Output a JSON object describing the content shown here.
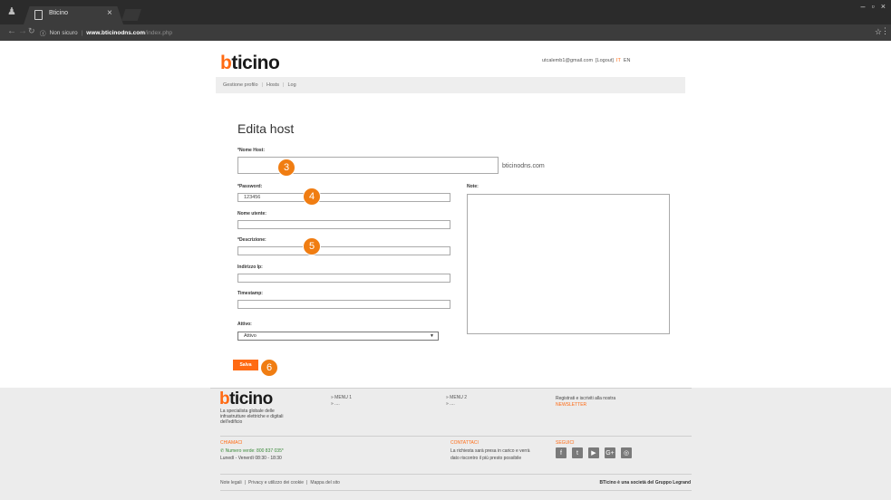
{
  "browser": {
    "tab_title": "Bticino",
    "tab_close": "×",
    "window_controls": [
      "–",
      "▫",
      "×"
    ],
    "url_security": "Non sicuro",
    "url_host": "www.bticinodns.com",
    "url_path": "/index.php"
  },
  "header": {
    "logo_b": "b",
    "logo_rest": "ticino",
    "user_email": "utcalemb1@gmail.com",
    "logout": "[Logout]",
    "lang_it": "IT",
    "lang_en": "EN"
  },
  "nav": {
    "items": [
      "Gestione profilo",
      "Hosts",
      "Log"
    ],
    "separator": "|"
  },
  "form": {
    "title": "Edita host",
    "host_name_label": "*Nome Host:",
    "host_name_value": "",
    "domain_suffix": "bticinodns.com",
    "password_label": "*Password:",
    "password_value": "123456",
    "username_label": "Nome utente:",
    "username_value": "",
    "description_label": "*Descrizione:",
    "description_value": "",
    "ip_label": "Indirizzo Ip:",
    "ip_value": "",
    "timestamp_label": "Timestamp:",
    "timestamp_value": "",
    "active_label": "Attivo:",
    "active_value": "Attivo",
    "notes_label": "Note:",
    "save_label": "Salva"
  },
  "callouts": [
    "3",
    "4",
    "5",
    "6"
  ],
  "footer": {
    "tagline": "La specialista globale delle infrastrutture elettriche e digitali dell'edificio",
    "menu1": "» MENU 1",
    "menu1_sub": "» ....",
    "menu2": "» MENU 2",
    "menu2_sub": "» ....",
    "newsletter_text": "Registrati e iscriviti alla nostra",
    "newsletter_link": "NEWSLETTER",
    "call_title": "CHIAMACI",
    "call_phone": "Numero verde: 800 837 035*",
    "call_hours": "Lunedì - Venerdì 08:30 - 18:30",
    "contact_title": "CONTATTACI",
    "contact_line1": "La richiesta sarà presa in carico e verrà",
    "contact_line2": "dato riscontro il più presto possibile",
    "follow_title": "SEGUICI",
    "socials": [
      "f",
      "t",
      "▶",
      "G+",
      "◎"
    ],
    "legal": [
      "Note legali",
      "Privacy e utilizzo dei cookie",
      "Mappa del sito"
    ],
    "legal_sep": "|",
    "group": "BTicino è una società del Gruppo Legrand"
  }
}
